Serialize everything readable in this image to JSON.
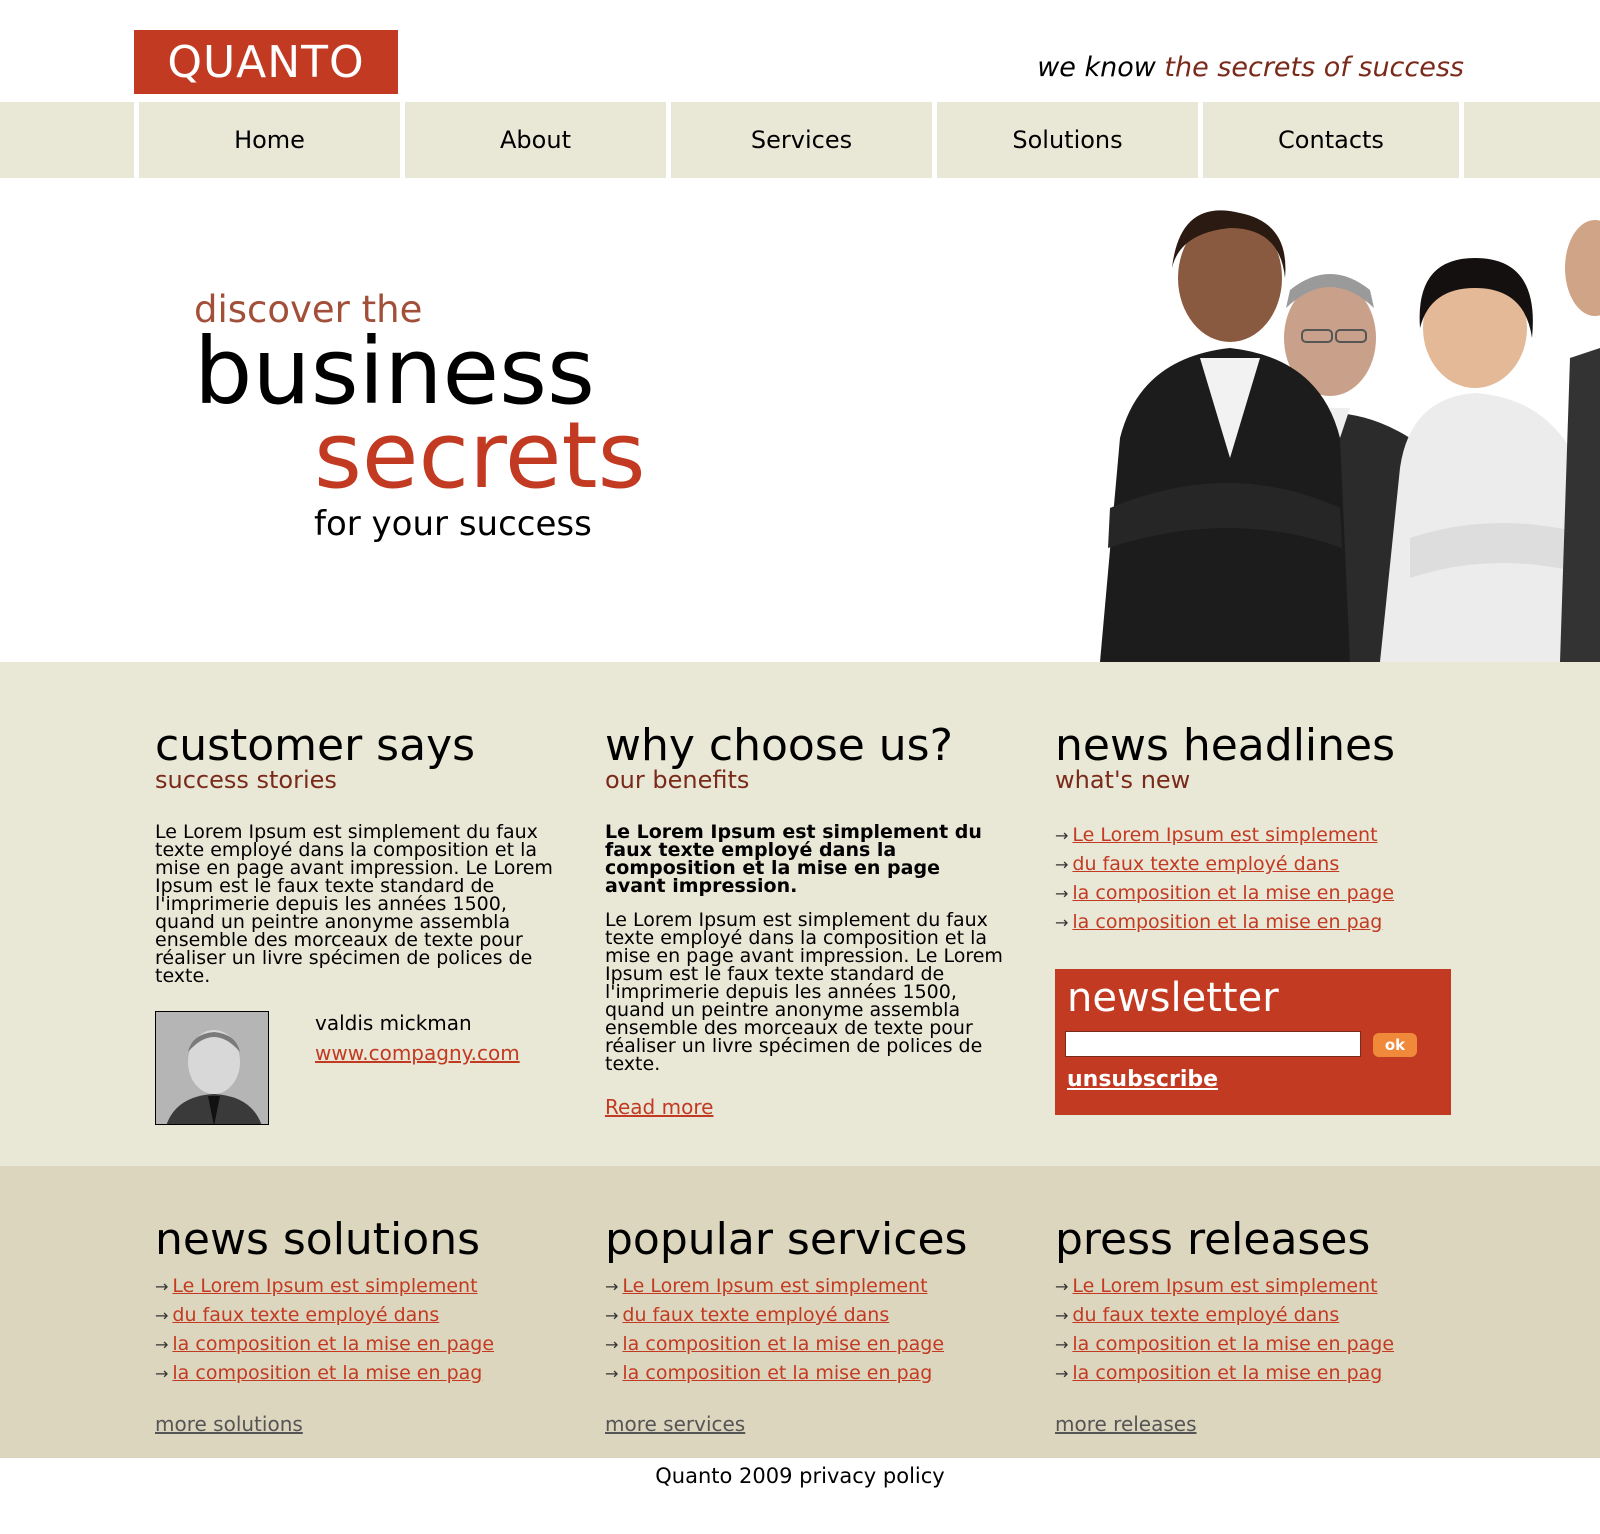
{
  "header": {
    "logo": "QUANTO",
    "tagline_prefix": "we know ",
    "tagline_accent": "the secrets of success"
  },
  "nav": {
    "items": [
      "Home",
      "About",
      "Services",
      "Solutions",
      "Contacts"
    ]
  },
  "hero": {
    "line1": "discover the",
    "line2": "business",
    "line3": "secrets",
    "line4": "for your success"
  },
  "customer": {
    "title": "customer says",
    "subtitle": "success stories",
    "text": "Le Lorem Ipsum est simplement du faux texte employé dans la composition et la mise en page avant impression. Le Lorem Ipsum est le faux texte standard de l'imprimerie depuis les années 1500, quand un peintre anonyme assembla ensemble des morceaux de texte pour réaliser un livre spécimen de polices de texte.",
    "name": "valdis mickman",
    "url": "www.compagny.com"
  },
  "why": {
    "title": "why choose us?",
    "subtitle": "our benefits",
    "bold_text": "Le Lorem Ipsum est simplement du faux texte employé dans la composition et la mise en page avant impression.",
    "text": "Le Lorem Ipsum est simplement du faux texte employé dans la composition et la mise en page avant impression. Le Lorem Ipsum est le faux texte standard de l'imprimerie depuis les années 1500, quand un peintre anonyme assembla ensemble des morceaux de texte pour réaliser un livre spécimen de polices de texte.",
    "read_more": "Read more"
  },
  "news": {
    "title": "news headlines",
    "subtitle": "what's new",
    "items": [
      "Le Lorem Ipsum est simplement",
      "du faux texte employé dans",
      "la composition et la mise en page",
      "la composition et la mise en pag"
    ]
  },
  "newsletter": {
    "title": "newsletter",
    "input_value": "",
    "ok": "ok",
    "unsubscribe": "unsubscribe"
  },
  "solutions": {
    "title": "news solutions",
    "items": [
      "Le Lorem Ipsum est simplement",
      "du faux texte employé dans",
      "la composition et la mise en page",
      "la composition et la mise en pag"
    ],
    "more": "more solutions"
  },
  "services": {
    "title": "popular services",
    "items": [
      "Le Lorem Ipsum est simplement",
      "du faux texte employé dans",
      "la composition et la mise en page",
      "la composition et la mise en pag"
    ],
    "more": "more services"
  },
  "releases": {
    "title": "press releases",
    "items": [
      "Le Lorem Ipsum est simplement",
      "du faux texte employé dans",
      "la composition et la mise en page",
      "la composition et la mise en pag"
    ],
    "more": "more releases"
  },
  "footer": {
    "text": "Quanto 2009 privacy policy"
  },
  "colors": {
    "brand": "#c23a22",
    "nav_bg": "#e9e7d6",
    "bottom_bg": "#dcd6be",
    "accent_dark": "#7a2a1a"
  },
  "icons": {
    "list_arrow": "arrow-right-icon"
  }
}
